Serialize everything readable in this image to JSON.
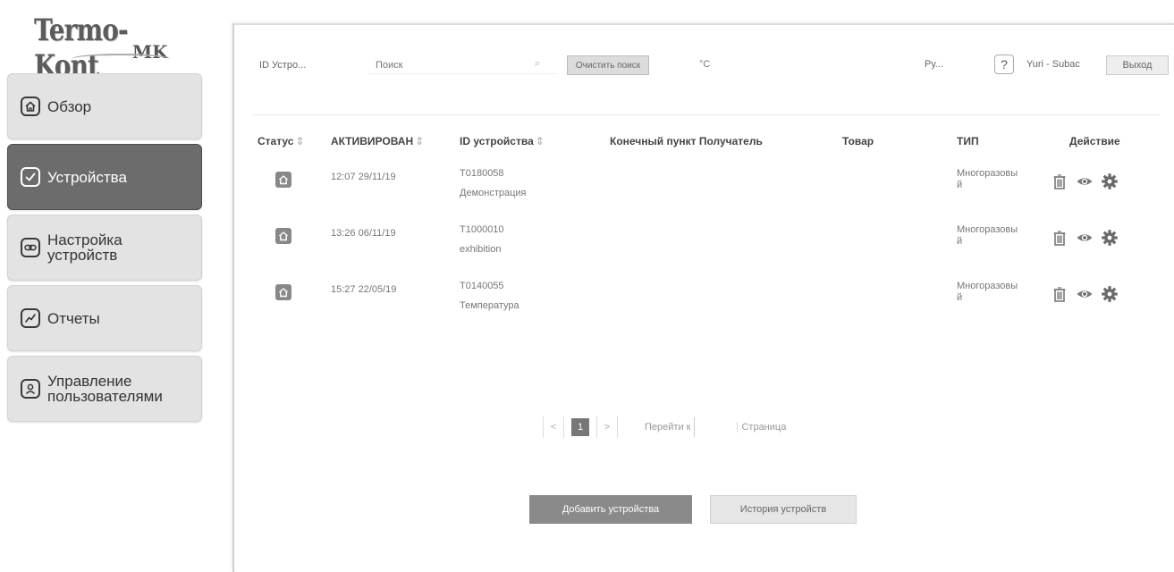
{
  "logo": {
    "main": "Termo-Kont",
    "sub": "MK"
  },
  "sidebar": {
    "items": [
      {
        "label": "Обзор",
        "icon": "home-icon",
        "active": false
      },
      {
        "label": "Устройства",
        "icon": "check-icon",
        "active": true
      },
      {
        "label": "Настройка устройств",
        "icon": "link-icon",
        "active": false
      },
      {
        "label": "Отчеты",
        "icon": "chart-icon",
        "active": false
      },
      {
        "label": "Управление пользователями",
        "icon": "user-icon",
        "active": false
      }
    ]
  },
  "toolbar": {
    "filter_select": "ID Устро...",
    "search_placeholder": "Поиск",
    "clear_button": "Очистить поиск",
    "temp_unit": "°C",
    "language": "Ру...",
    "help": "?",
    "user": "Yuri - Subac",
    "logout": "Выход"
  },
  "table": {
    "headers": {
      "status": "Статус",
      "activated": "АКТИВИРОВАН",
      "device_id": "ID устройства",
      "destination": "Конечный пункт Получатель",
      "product": "Товар",
      "type": "ТИП",
      "action": "Действие"
    },
    "rows": [
      {
        "activated": "12:07 29/11/19",
        "device_id": "T0180058",
        "device_name": "Демонстрация",
        "type_line1": "Многоразовы",
        "type_line2": "й"
      },
      {
        "activated": "13:26 06/11/19",
        "device_id": "T1000010",
        "device_name": "exhibition",
        "type_line1": "Многоразовы",
        "type_line2": "й"
      },
      {
        "activated": "15:27 22/05/19",
        "device_id": "T0140055",
        "device_name": "Температура",
        "type_line1": "Многоразовы",
        "type_line2": "й"
      }
    ]
  },
  "pagination": {
    "prev": "<",
    "current": "1",
    "next": ">",
    "goto_label": "Перейти к",
    "page_label": "Страница"
  },
  "buttons": {
    "add_devices": "Добавить устройства",
    "device_history": "История устройств"
  }
}
